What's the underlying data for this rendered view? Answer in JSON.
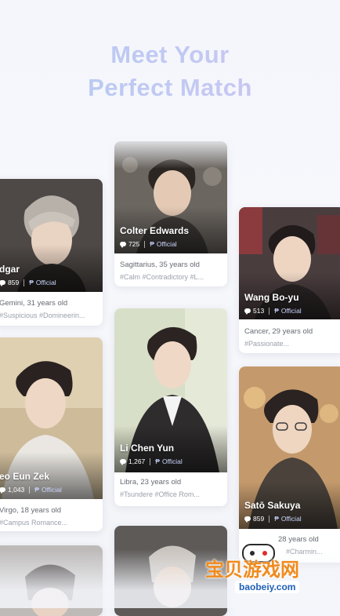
{
  "headline": {
    "line1": "Meet Your",
    "line2": "Perfect Match"
  },
  "cards": [
    {
      "name": "dgar",
      "chats": "859",
      "official": "Official",
      "meta": "Gemini, 31 years old",
      "tags": "#Suspicious #Domineerin..."
    },
    {
      "name": "Colter Edwards",
      "chats": "725",
      "official": "Official",
      "meta": "Sagittarius, 35 years old",
      "tags": "#Calm #Contradictory #L..."
    },
    {
      "name": "Wang Bo-yu",
      "chats": "513",
      "official": "Official",
      "meta": "Cancer, 29 years old",
      "tags": "#Passionate..."
    },
    {
      "name": "eo Eun Zek",
      "chats": "1,043",
      "official": "Official",
      "meta": "Virgo, 18 years old",
      "tags": "#Campus Romance..."
    },
    {
      "name": "Li Chen Yun",
      "chats": "1,267",
      "official": "Official",
      "meta": "Libra, 23 years old",
      "tags": "#Tsundere #Office Rom..."
    },
    {
      "name": "Satō Sakuya",
      "chats": "859",
      "official": "Official",
      "meta": "28 years old",
      "tags": "#Charmin..."
    }
  ],
  "watermark": {
    "text": "宝贝游戏网",
    "url": "baobeiy.com"
  }
}
